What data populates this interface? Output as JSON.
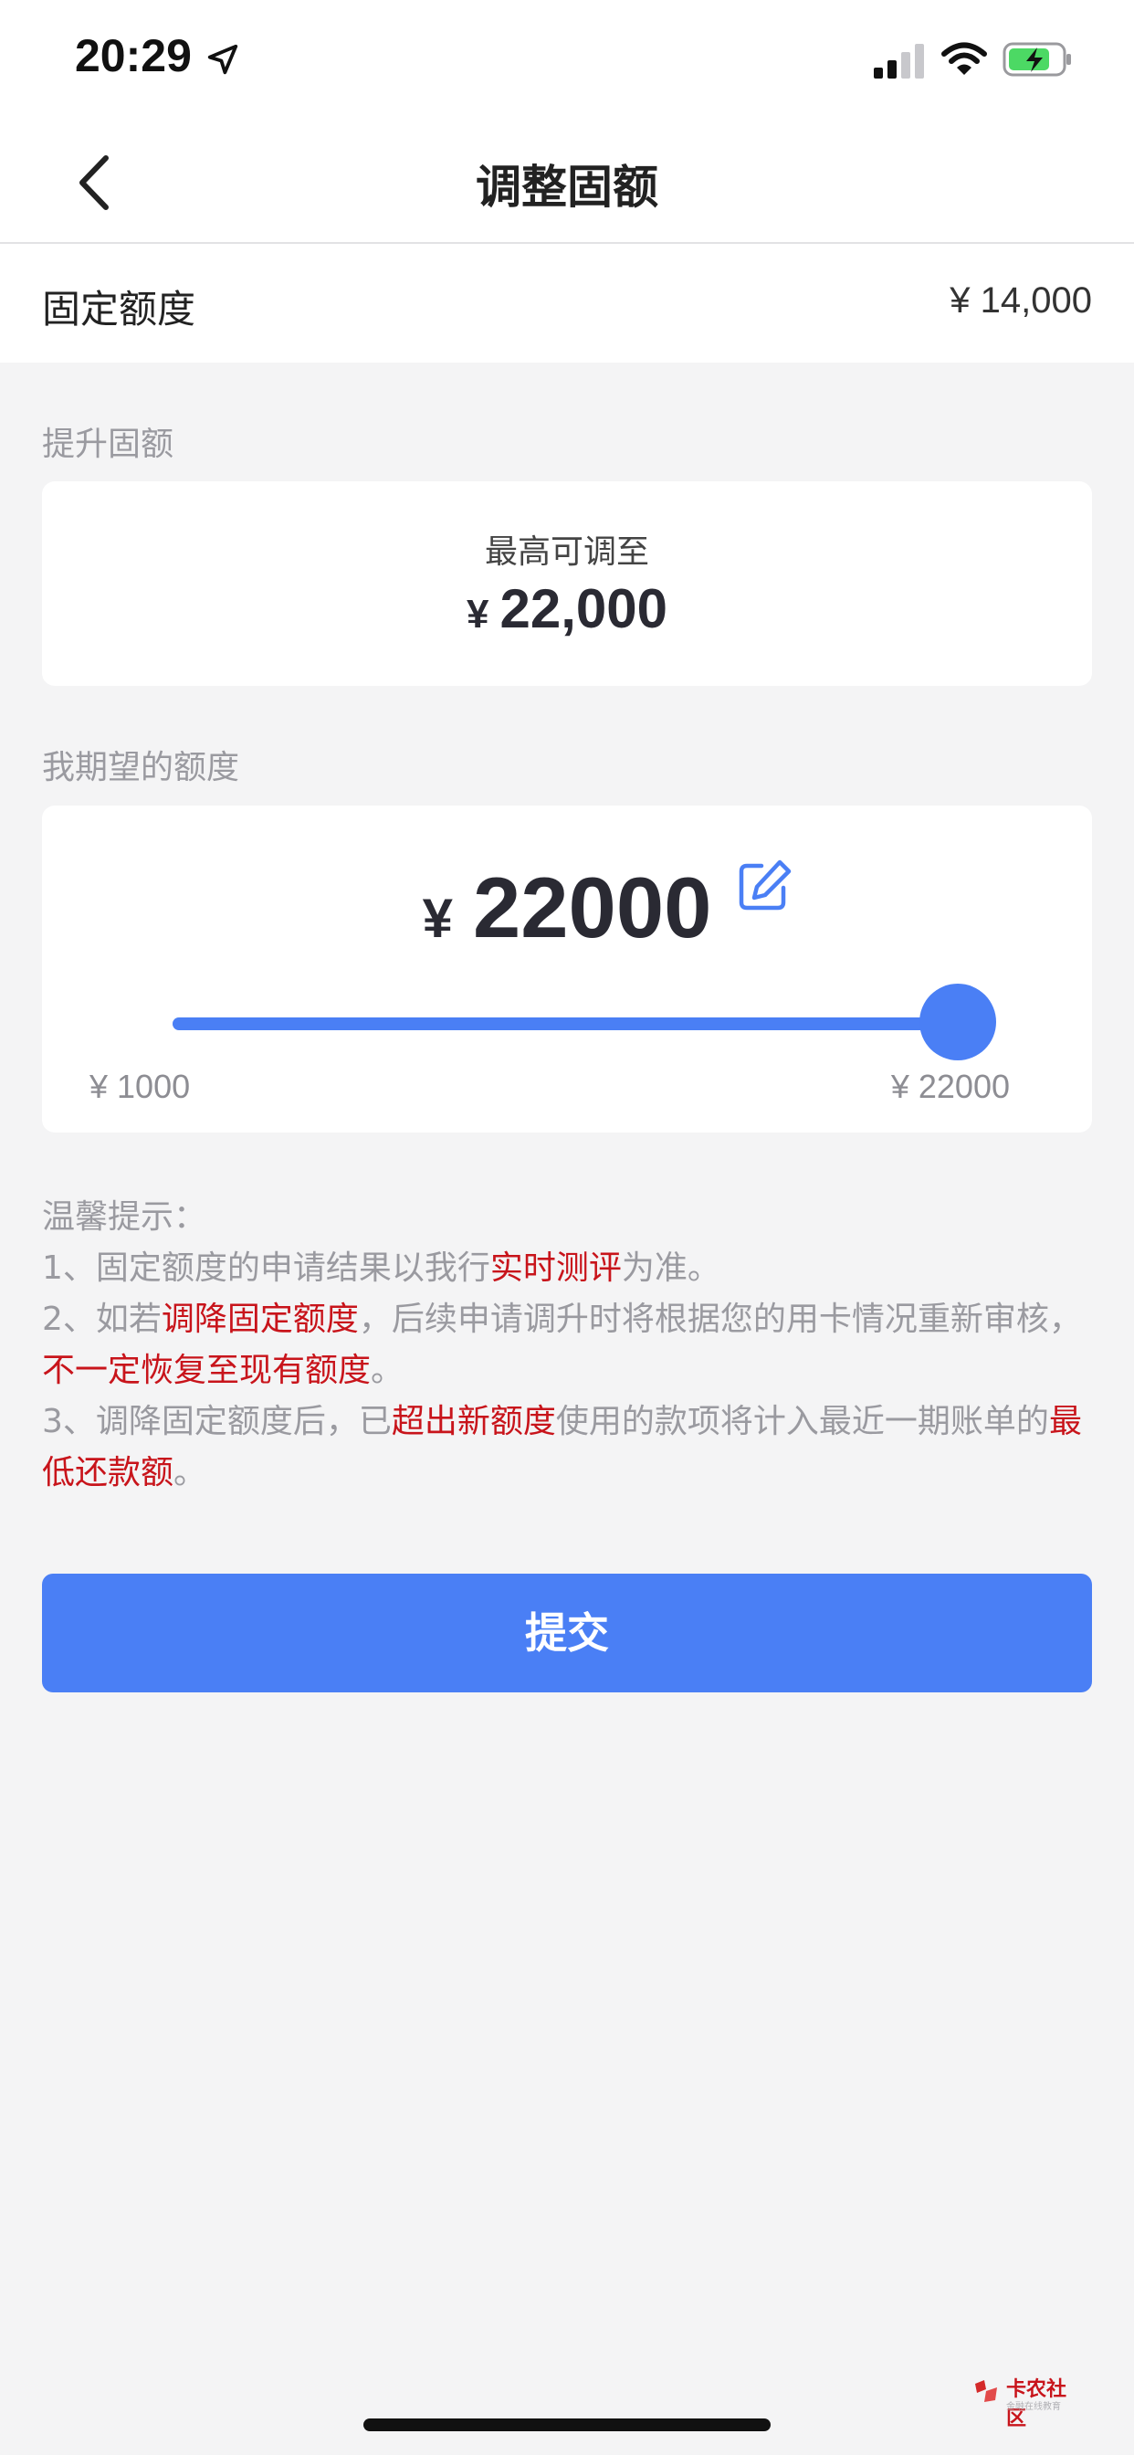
{
  "status_bar": {
    "time": "20:29",
    "icons": [
      "location-arrow-icon",
      "signal-icon",
      "wifi-icon",
      "battery-charging-icon"
    ],
    "signal_bars": 2
  },
  "nav": {
    "title": "调整固额",
    "back_icon": "chevron-left-icon"
  },
  "fixed_limit": {
    "label": "固定额度",
    "value": "¥ 14,000"
  },
  "raise_section": {
    "label": "提升固额",
    "caption": "最高可调至",
    "currency": "¥",
    "max_value": "22,000"
  },
  "expected_section": {
    "label": "我期望的额度",
    "currency": "¥",
    "amount": "22000",
    "edit_icon": "edit-icon",
    "slider": {
      "min_label": "¥ 1000",
      "max_label": "¥ 22000",
      "min": 1000,
      "max": 22000,
      "value": 22000
    }
  },
  "tips": {
    "title": "温馨提示：",
    "item1_pre": "1、固定额度的申请结果以我行",
    "item1_hl": "实时测评",
    "item1_post": "为准。",
    "item2_pre": "2、如若",
    "item2_hl1": "调降固定额度",
    "item2_mid": "，后续申请调升时将根据您的用卡情况重新审核，",
    "item2_hl2": "不一定恢复至现有额度",
    "item2_post": "。",
    "item3_pre": "3、调降固定额度后，已",
    "item3_hl1": "超出新额度",
    "item3_mid": "使用的款项将计入最近一期账单的",
    "item3_hl2": "最低还款额",
    "item3_post": "。"
  },
  "submit_label": "提交",
  "watermark": {
    "title": "卡农社区",
    "subtitle": "金融在线教育"
  },
  "colors": {
    "accent": "#4a7ff5",
    "highlight": "#c8141b",
    "background": "#f4f4f5"
  }
}
